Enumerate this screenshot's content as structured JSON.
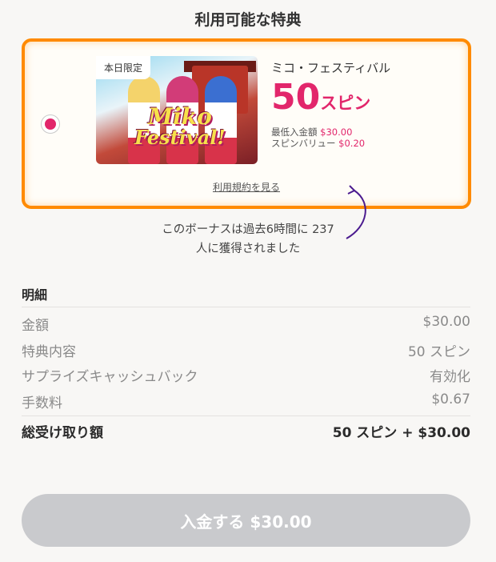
{
  "header": {
    "title": "利用可能な特典"
  },
  "offer": {
    "badge": "本日限定",
    "game_name": "ミコ・フェスティバル",
    "spins_number": "50",
    "spins_unit": "スピン",
    "min_deposit_label": "最低入金額",
    "min_deposit_value": "$30.00",
    "spin_value_label": "スピンバリュー",
    "spin_value_value": "$0.20",
    "terms_link": "利用規約を見る",
    "logo_line1": "Miko",
    "logo_line2": "Festival!",
    "selected": true,
    "accent_color": "#e2266b",
    "border_color": "#ff8a00"
  },
  "notice": {
    "line1": "このボーナスは過去6時間に 237",
    "line2": "人に獲得されました"
  },
  "summary": {
    "title": "明細",
    "rows": [
      {
        "label": "金額",
        "value": "$30.00"
      },
      {
        "label": "特典内容",
        "value": "50 スピン"
      },
      {
        "label": "サプライズキャッシュバック",
        "value": "有効化"
      },
      {
        "label": "手数料",
        "value": "$0.67"
      }
    ],
    "total": {
      "label": "総受け取り額",
      "value": "50 スピン + $30.00"
    }
  },
  "deposit_button": {
    "label": "入金する $30.00",
    "enabled": false
  }
}
